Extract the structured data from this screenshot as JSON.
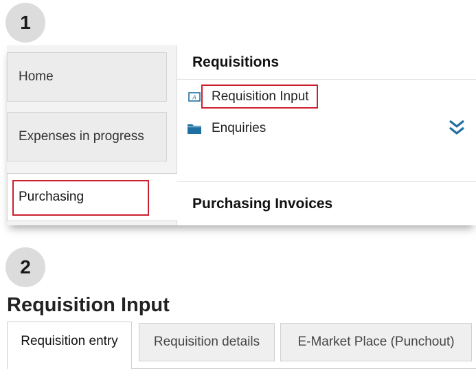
{
  "steps": {
    "step1": "1",
    "step2": "2"
  },
  "nav": {
    "home": "Home",
    "expenses": "Expenses in progress",
    "purchasing": "Purchasing"
  },
  "menu": {
    "requisitions_header": "Requisitions",
    "requisition_input": "Requisition Input",
    "enquiries": "Enquiries",
    "purchasing_invoices_header": "Purchasing Invoices"
  },
  "page": {
    "title": "Requisition Input",
    "tabs": [
      {
        "label": "Requisition entry",
        "active": true
      },
      {
        "label": "Requisition details",
        "active": false
      },
      {
        "label": "E-Market Place (Punchout)",
        "active": false
      }
    ]
  },
  "colors": {
    "highlight": "#cc1f2d",
    "icon_blue": "#1f6fa3",
    "badge_bg": "#dcdcdc"
  },
  "icons": {
    "requisition_input": "form-input-icon",
    "enquiries": "folder-icon",
    "expand": "double-chevron-down-icon"
  }
}
